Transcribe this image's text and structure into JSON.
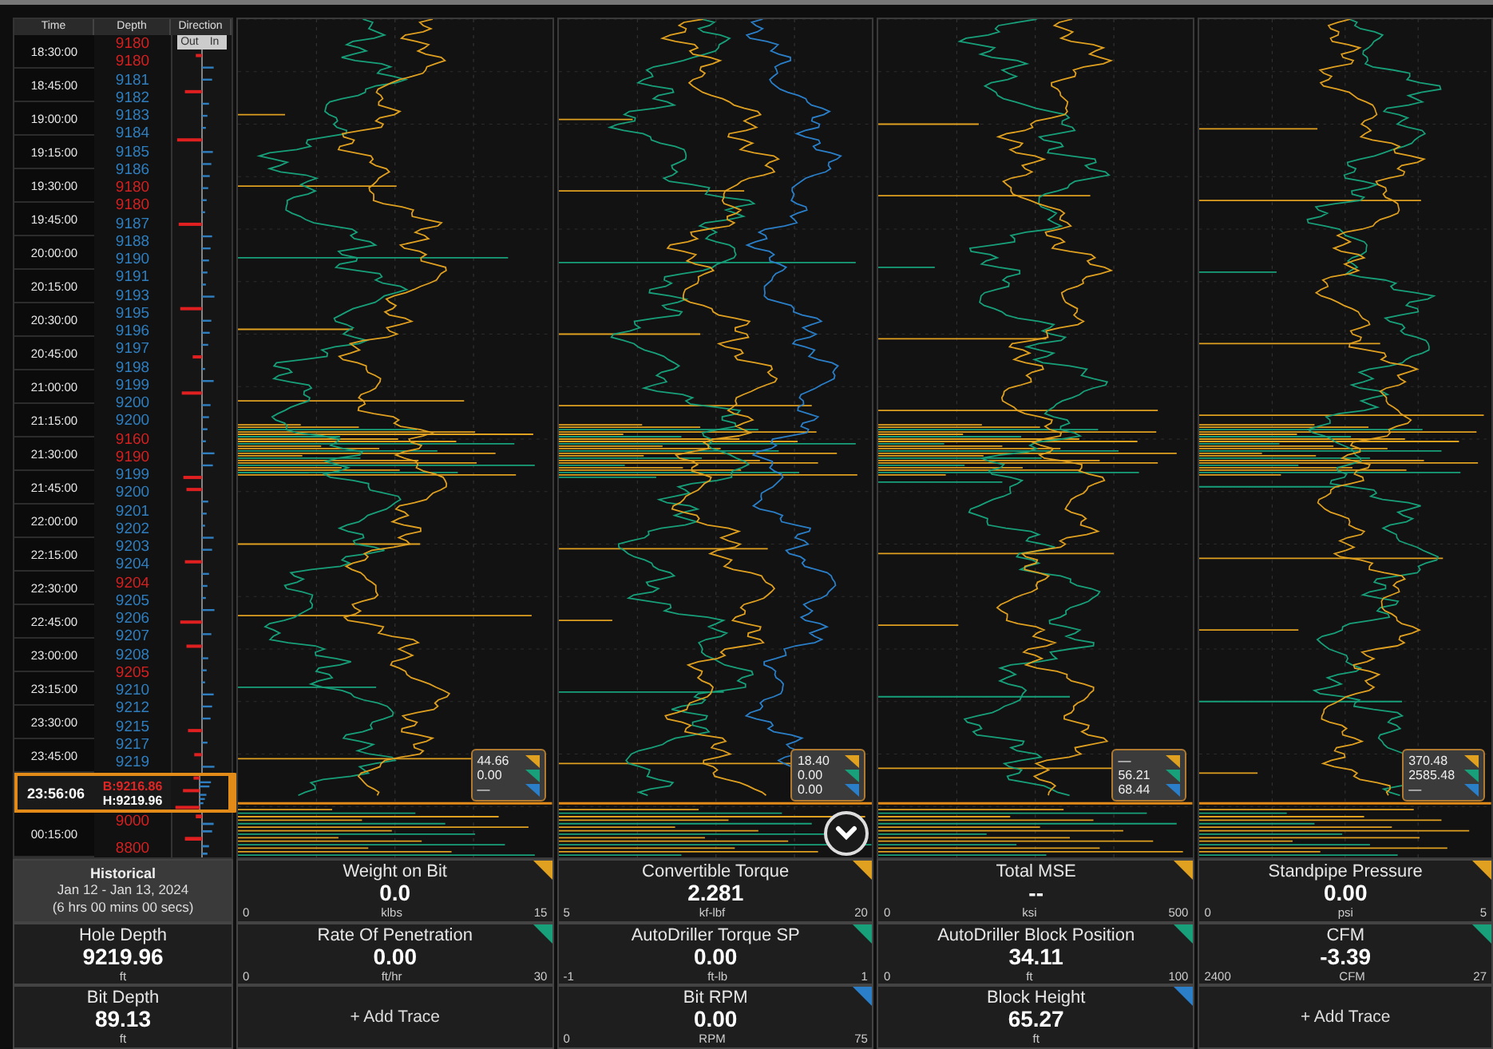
{
  "log": {
    "headers": {
      "time": "Time",
      "depth": "Depth",
      "direction": "Direction"
    },
    "direction_labels": [
      "Out",
      "In"
    ],
    "times": [
      "18:30:00",
      "18:45:00",
      "19:00:00",
      "19:15:00",
      "19:30:00",
      "19:45:00",
      "20:00:00",
      "20:15:00",
      "20:30:00",
      "20:45:00",
      "21:00:00",
      "21:15:00",
      "21:30:00",
      "21:45:00",
      "22:00:00",
      "22:15:00",
      "22:30:00",
      "22:45:00",
      "23:00:00",
      "23:15:00",
      "23:30:00",
      "23:45:00"
    ],
    "depths": [
      {
        "text": "9180",
        "color": "#d42020"
      },
      {
        "text": "9180",
        "color": "#d42020"
      },
      {
        "text": "9181",
        "color": "#2f7fc0"
      },
      {
        "text": "9182",
        "color": "#2f7fc0"
      },
      {
        "text": "9183",
        "color": "#2f7fc0"
      },
      {
        "text": "9184",
        "color": "#2f7fc0"
      },
      {
        "text": "9185",
        "color": "#2f7fc0"
      },
      {
        "text": "9186",
        "color": "#2f7fc0"
      },
      {
        "text": "9180",
        "color": "#d42020"
      },
      {
        "text": "9180",
        "color": "#d42020"
      },
      {
        "text": "9187",
        "color": "#2f7fc0"
      },
      {
        "text": "9188",
        "color": "#2f7fc0"
      },
      {
        "text": "9190",
        "color": "#2f7fc0"
      },
      {
        "text": "9191",
        "color": "#2f7fc0"
      },
      {
        "text": "9193",
        "color": "#2f7fc0"
      },
      {
        "text": "9195",
        "color": "#2f7fc0"
      },
      {
        "text": "9196",
        "color": "#2f7fc0"
      },
      {
        "text": "9197",
        "color": "#2f7fc0"
      },
      {
        "text": "9198",
        "color": "#2f7fc0"
      },
      {
        "text": "9199",
        "color": "#2f7fc0"
      },
      {
        "text": "9200",
        "color": "#2f7fc0"
      },
      {
        "text": "9200",
        "color": "#2f7fc0"
      },
      {
        "text": "9160",
        "color": "#d42020"
      },
      {
        "text": "9190",
        "color": "#d42020"
      },
      {
        "text": "9199",
        "color": "#2f7fc0"
      },
      {
        "text": "9200",
        "color": "#2f7fc0"
      },
      {
        "text": "9201",
        "color": "#2f7fc0"
      },
      {
        "text": "9202",
        "color": "#2f7fc0"
      },
      {
        "text": "9203",
        "color": "#2f7fc0"
      },
      {
        "text": "9204",
        "color": "#2f7fc0"
      },
      {
        "text": "9204",
        "color": "#d42020"
      },
      {
        "text": "9205",
        "color": "#2f7fc0"
      },
      {
        "text": "9206",
        "color": "#2f7fc0"
      },
      {
        "text": "9207",
        "color": "#2f7fc0"
      },
      {
        "text": "9208",
        "color": "#2f7fc0"
      },
      {
        "text": "9205",
        "color": "#d42020"
      },
      {
        "text": "9210",
        "color": "#2f7fc0"
      },
      {
        "text": "9212",
        "color": "#2f7fc0"
      },
      {
        "text": "9215",
        "color": "#2f7fc0"
      },
      {
        "text": "9217",
        "color": "#2f7fc0"
      },
      {
        "text": "9219",
        "color": "#2f7fc0"
      }
    ],
    "cursor": {
      "time": "23:56:06",
      "bit": "B:9216.86",
      "hole": "H:9219.96"
    },
    "after_times": [
      "00:15:00"
    ],
    "after_depths": [
      {
        "text": "9000",
        "color": "#d42020"
      },
      {
        "text": "8800",
        "color": "#d42020"
      }
    ]
  },
  "info": {
    "historical": {
      "title": "Historical",
      "range": "Jan 12 - Jan 13, 2024",
      "duration": "(6 hrs 00 mins 00 secs)"
    },
    "readouts": [
      {
        "name": "Hole Depth",
        "value": "9219.96",
        "unit": "ft"
      },
      {
        "name": "Bit Depth",
        "value": "89.13",
        "unit": "ft"
      }
    ]
  },
  "tracks": [
    {
      "legend": [
        {
          "value": "44.66",
          "color": "#e0a020"
        },
        {
          "value": "0.00",
          "color": "#17a07a"
        },
        {
          "value": "—",
          "color": "#2a7fc8"
        }
      ],
      "gauges": [
        {
          "kind": "gauge",
          "name": "Weight on Bit",
          "value": "0.0",
          "unit": "klbs",
          "min": "0",
          "max": "15",
          "color": "#e0a020"
        },
        {
          "kind": "gauge",
          "name": "Rate Of Penetration",
          "value": "0.00",
          "unit": "ft/hr",
          "min": "0",
          "max": "30",
          "color": "#17a07a"
        },
        {
          "kind": "add",
          "label": "+ Add Trace"
        }
      ]
    },
    {
      "legend": [
        {
          "value": "18.40",
          "color": "#e0a020"
        },
        {
          "value": "0.00",
          "color": "#17a07a"
        },
        {
          "value": "0.00",
          "color": "#2a7fc8"
        }
      ],
      "gauges": [
        {
          "kind": "gauge",
          "name": "Convertible Torque",
          "value": "2.281",
          "unit": "kf-lbf",
          "min": "5",
          "max": "20",
          "color": "#e0a020"
        },
        {
          "kind": "gauge",
          "name": "AutoDriller Torque SP",
          "value": "0.00",
          "unit": "ft-lb",
          "min": "-1",
          "max": "1",
          "color": "#17a07a"
        },
        {
          "kind": "gauge",
          "name": "Bit RPM",
          "value": "0.00",
          "unit": "RPM",
          "min": "0",
          "max": "75",
          "color": "#2a7fc8"
        }
      ]
    },
    {
      "legend": [
        {
          "value": "—",
          "color": "#e0a020"
        },
        {
          "value": "56.21",
          "color": "#17a07a"
        },
        {
          "value": "68.44",
          "color": "#2a7fc8"
        }
      ],
      "gauges": [
        {
          "kind": "gauge",
          "name": "Total MSE",
          "value": "--",
          "unit": "ksi",
          "min": "0",
          "max": "500",
          "color": "#e0a020"
        },
        {
          "kind": "gauge",
          "name": "AutoDriller Block Position",
          "value": "34.11",
          "unit": "ft",
          "min": "0",
          "max": "100",
          "color": "#17a07a"
        },
        {
          "kind": "gauge",
          "name": "Block Height",
          "value": "65.27",
          "unit": "ft",
          "color": "#2a7fc8"
        }
      ]
    },
    {
      "legend": [
        {
          "value": "370.48",
          "color": "#e0a020"
        },
        {
          "value": "2585.48",
          "color": "#17a07a"
        },
        {
          "value": "—",
          "color": "#2a7fc8"
        }
      ],
      "gauges": [
        {
          "kind": "gauge",
          "name": "Standpipe Pressure",
          "value": "0.00",
          "unit": "psi",
          "min": "0",
          "max": "5",
          "color": "#e0a020"
        },
        {
          "kind": "gauge",
          "name": "CFM",
          "value": "-3.39",
          "unit": "CFM",
          "min": "2400",
          "max": "27",
          "color": "#17a07a"
        },
        {
          "kind": "add",
          "label": "+ Add Trace"
        }
      ]
    }
  ]
}
